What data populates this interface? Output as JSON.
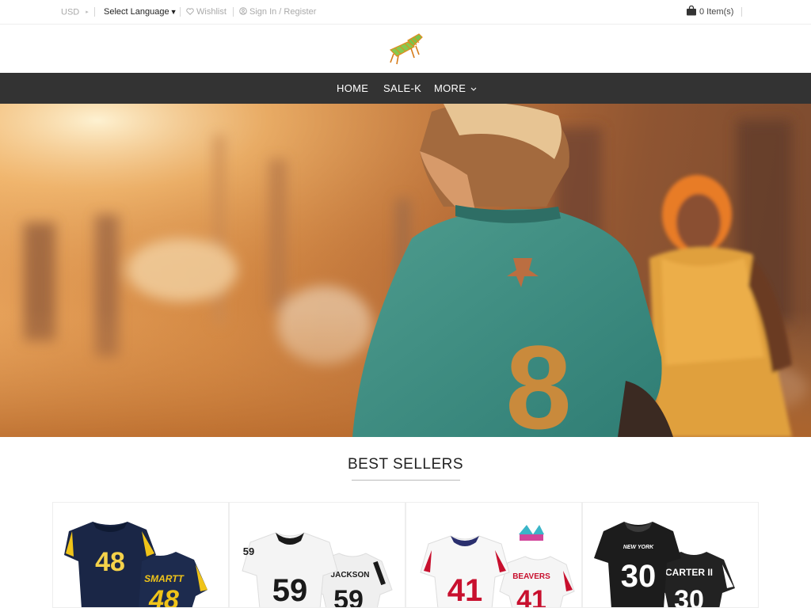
{
  "topbar": {
    "currency": "USD",
    "language": "Select Language",
    "wishlist": "Wishlist",
    "signin": "Sign In / Register",
    "cart": "0 Item(s)"
  },
  "logo": {
    "icon": "beach-chair-logo"
  },
  "nav": {
    "items": [
      {
        "label": "HOME"
      },
      {
        "label": "SALE-K"
      },
      {
        "label": "MORE"
      }
    ]
  },
  "hero": {
    "jersey_number": "8"
  },
  "best_sellers": {
    "title": "BEST SELLERS",
    "products": [
      {
        "front_number": "48",
        "back_name": "SMARTT",
        "back_number": "48",
        "jersey_color": "#1d2b4e",
        "number_color": "#f0c419"
      },
      {
        "front_number": "59",
        "back_name": "JACKSON",
        "back_number": "59",
        "jersey_color": "#f2f2f2",
        "number_color": "#1a1a1a"
      },
      {
        "front_number": "41",
        "back_name": "BEAVERS",
        "back_number": "41",
        "jersey_color": "#f5f5f5",
        "number_color": "#c8102e"
      },
      {
        "front_number": "30",
        "back_name": "CARTER II",
        "back_number": "30",
        "jersey_color": "#1f1f1f",
        "number_color": "#ffffff",
        "front_wordmark": "NEW YORK"
      }
    ]
  },
  "colors": {
    "nav_bg": "#333333",
    "topbar_text": "#aaaaaa"
  }
}
